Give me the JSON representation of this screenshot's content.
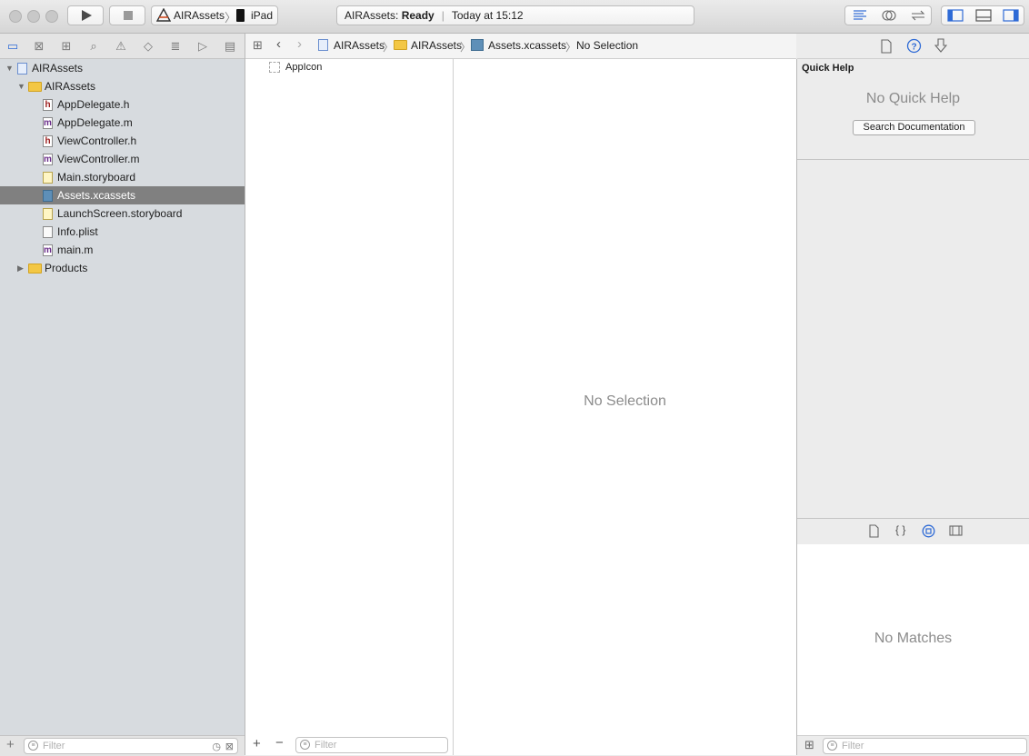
{
  "toolbar": {
    "scheme": "AIRAssets",
    "destination": "iPad",
    "status_project": "AIRAssets:",
    "status_state": "Ready",
    "status_time": "Today at 15:12"
  },
  "icons": {
    "navigator_tabs": [
      "folder-icon",
      "issue-x-icon",
      "hierarchy-icon",
      "search-icon",
      "warning-icon",
      "test-diamond-icon",
      "debug-list-icon",
      "breakpoint-icon",
      "report-icon"
    ],
    "inspector_tabs": [
      "file-icon",
      "quick-help-icon",
      "attributes-icon"
    ],
    "library_tabs": [
      "file-template-icon",
      "code-snippet-icon",
      "object-icon",
      "media-icon"
    ]
  },
  "navigator": {
    "items": [
      {
        "label": "AIRAssets",
        "type": "project",
        "indent": 0,
        "disclosure": "open"
      },
      {
        "label": "AIRAssets",
        "type": "folder",
        "indent": 1,
        "disclosure": "open"
      },
      {
        "label": "AppDelegate.h",
        "type": "h",
        "indent": 2
      },
      {
        "label": "AppDelegate.m",
        "type": "m",
        "indent": 2
      },
      {
        "label": "ViewController.h",
        "type": "h",
        "indent": 2
      },
      {
        "label": "ViewController.m",
        "type": "m",
        "indent": 2
      },
      {
        "label": "Main.storyboard",
        "type": "storyboard",
        "indent": 2
      },
      {
        "label": "Assets.xcassets",
        "type": "xcassets",
        "indent": 2,
        "selected": true
      },
      {
        "label": "LaunchScreen.storyboard",
        "type": "storyboard",
        "indent": 2
      },
      {
        "label": "Info.plist",
        "type": "plist",
        "indent": 2
      },
      {
        "label": "main.m",
        "type": "m",
        "indent": 2
      },
      {
        "label": "Products",
        "type": "folder",
        "indent": 1,
        "disclosure": "closed"
      }
    ],
    "filter_placeholder": "Filter"
  },
  "jumpbar": {
    "crumbs": [
      "AIRAssets",
      "AIRAssets",
      "Assets.xcassets",
      "No Selection"
    ]
  },
  "assets": {
    "items": [
      "AppIcon"
    ],
    "filter_placeholder": "Filter"
  },
  "editor": {
    "empty_text": "No Selection"
  },
  "inspector": {
    "title": "Quick Help",
    "empty_text": "No Quick Help",
    "search_button": "Search Documentation"
  },
  "library": {
    "empty_text": "No Matches",
    "filter_placeholder": "Filter"
  }
}
